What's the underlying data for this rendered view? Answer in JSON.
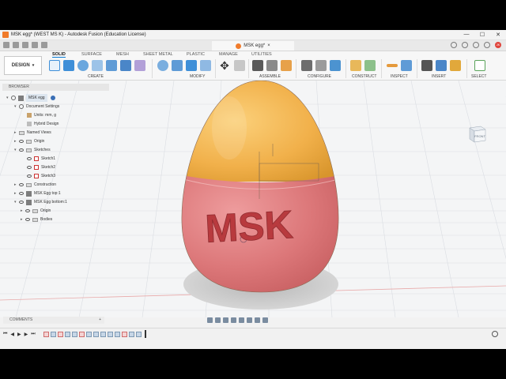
{
  "window": {
    "title": "MSK egg* (WEST MS K) - Autodesk Fusion (Education License)"
  },
  "document_tab": {
    "label": "MSK egg*"
  },
  "toolbar": {
    "workspace_button": "DESIGN",
    "workspace_tabs": [
      "SOLID",
      "SURFACE",
      "MESH",
      "SHEET METAL",
      "PLASTIC",
      "MANAGE",
      "UTILITIES"
    ],
    "active_tab": "SOLID",
    "groups": [
      "CREATE",
      "MODIFY",
      "ASSEMBLE",
      "CONFIGURE",
      "CONSTRUCT",
      "INSPECT",
      "INSERT",
      "SELECT"
    ]
  },
  "browser": {
    "header": "BROWSER",
    "items": [
      {
        "label": "MSK egg",
        "icon": "component-icon"
      },
      {
        "label": "Document Settings",
        "icon": "gear-icon"
      },
      {
        "label": "Units: mm, g",
        "icon": "document-icon"
      },
      {
        "label": "Hybrid Design",
        "icon": "document-icon"
      },
      {
        "label": "Named Views",
        "icon": "folder-icon"
      },
      {
        "label": "Origin",
        "icon": "folder-icon"
      },
      {
        "label": "Sketches",
        "icon": "folder-icon"
      },
      {
        "label": "Sketch1",
        "icon": "sketch-icon"
      },
      {
        "label": "Sketch2",
        "icon": "sketch-icon"
      },
      {
        "label": "Sketch3",
        "icon": "sketch-icon"
      },
      {
        "label": "Construction",
        "icon": "folder-icon"
      },
      {
        "label": "MSK Egg top:1",
        "icon": "component-icon"
      },
      {
        "label": "MSK Egg bottom:1",
        "icon": "component-icon"
      },
      {
        "label": "Origin",
        "icon": "folder-icon"
      },
      {
        "label": "Bodies",
        "icon": "folder-icon"
      }
    ]
  },
  "viewport": {
    "emboss_text": "MSK",
    "viewcube_label": "FRONT",
    "colors": {
      "egg_top": "#f1b04a",
      "egg_bottom": "#dc7779",
      "text": "#b83a3e"
    }
  },
  "comments": {
    "label": "COMMENTS"
  },
  "avatar": {
    "initials": "JK"
  }
}
